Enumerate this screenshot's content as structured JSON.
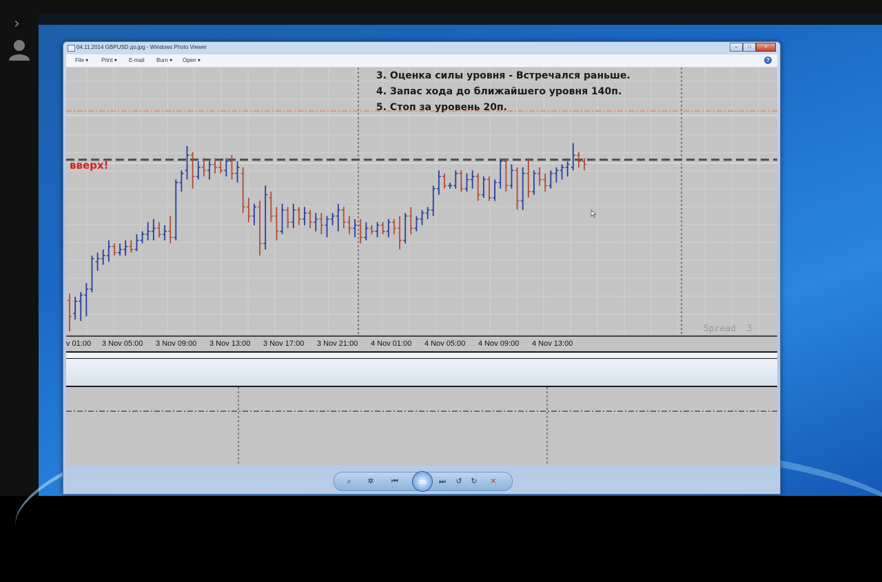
{
  "viewer": {
    "icons": [
      "chevron-right-icon",
      "user-icon"
    ]
  },
  "window": {
    "title": "04.11.2014 GBPUSD до.jpg - Windows Photo Viewer",
    "menu": [
      {
        "label": "File",
        "icon": "chevron-down-icon"
      },
      {
        "label": "Print",
        "icon": "chevron-down-icon"
      },
      {
        "label": "E-mail"
      },
      {
        "label": "Burn",
        "icon": "chevron-down-icon"
      },
      {
        "label": "Open",
        "icon": "chevron-down-icon"
      }
    ],
    "controls": {
      "minimize": "–",
      "maximize": "□",
      "close": "×"
    },
    "help": "?"
  },
  "image": {
    "notes": [
      "3. Оценка силы уровня - Встречался раньше.",
      "4. Запас хода до ближайшего уровня 140п.",
      "5. Стоп за уровень 20п."
    ],
    "direction_label": "вверх!",
    "spread_label": "Spread  3",
    "time_labels": [
      "v 01:00",
      "3 Nov 05:00",
      "3 Nov 09:00",
      "3 Nov 13:00",
      "3 Nov 17:00",
      "3 Nov 21:00",
      "4 Nov 01:00",
      "4 Nov 05:00",
      "4 Nov 09:00",
      "4 Nov 13:00"
    ],
    "colors": {
      "background": "#c4c4c4",
      "bull": "#2a3c9c",
      "bear": "#b34a38",
      "level_line": "#4a4a4a",
      "upper_level": "#e0885a"
    }
  },
  "chart_data": {
    "type": "ohlc",
    "bars": [
      {
        "o": 0.5,
        "h": 5,
        "l": -20,
        "c": -10
      },
      {
        "o": -8,
        "h": 3,
        "l": -12,
        "c": 0
      },
      {
        "o": 0,
        "h": 6,
        "l": -13,
        "c": 4
      },
      {
        "o": 4,
        "h": 12,
        "l": -10,
        "c": 8
      },
      {
        "o": 8,
        "h": 30,
        "l": 6,
        "c": 28
      },
      {
        "o": 26,
        "h": 32,
        "l": 20,
        "c": 28
      },
      {
        "o": 28,
        "h": 34,
        "l": 24,
        "c": 30
      },
      {
        "o": 30,
        "h": 40,
        "l": 26,
        "c": 36
      },
      {
        "o": 36,
        "h": 38,
        "l": 30,
        "c": 32
      },
      {
        "o": 32,
        "h": 38,
        "l": 30,
        "c": 34
      },
      {
        "o": 34,
        "h": 40,
        "l": 30,
        "c": 36
      },
      {
        "o": 36,
        "h": 40,
        "l": 32,
        "c": 34
      },
      {
        "o": 34,
        "h": 44,
        "l": 33,
        "c": 40
      },
      {
        "o": 40,
        "h": 46,
        "l": 38,
        "c": 44
      },
      {
        "o": 44,
        "h": 52,
        "l": 40,
        "c": 46
      },
      {
        "o": 46,
        "h": 54,
        "l": 40,
        "c": 48
      },
      {
        "o": 48,
        "h": 52,
        "l": 42,
        "c": 44
      },
      {
        "o": 44,
        "h": 50,
        "l": 40,
        "c": 46
      },
      {
        "o": 46,
        "h": 56,
        "l": 38,
        "c": 42
      },
      {
        "o": 42,
        "h": 80,
        "l": 40,
        "c": 78
      },
      {
        "o": 78,
        "h": 86,
        "l": 72,
        "c": 84
      },
      {
        "o": 86,
        "h": 102,
        "l": 80,
        "c": 96
      },
      {
        "o": 96,
        "h": 98,
        "l": 74,
        "c": 82
      },
      {
        "o": 82,
        "h": 92,
        "l": 80,
        "c": 88
      },
      {
        "o": 88,
        "h": 94,
        "l": 82,
        "c": 86
      },
      {
        "o": 86,
        "h": 92,
        "l": 80,
        "c": 90
      },
      {
        "o": 90,
        "h": 94,
        "l": 84,
        "c": 88
      },
      {
        "o": 88,
        "h": 92,
        "l": 84,
        "c": 86
      },
      {
        "o": 86,
        "h": 94,
        "l": 82,
        "c": 92
      },
      {
        "o": 92,
        "h": 96,
        "l": 80,
        "c": 84
      },
      {
        "o": 84,
        "h": 92,
        "l": 78,
        "c": 88
      },
      {
        "o": 84,
        "h": 88,
        "l": 58,
        "c": 62
      },
      {
        "o": 62,
        "h": 68,
        "l": 52,
        "c": 56
      },
      {
        "o": 56,
        "h": 64,
        "l": 50,
        "c": 62
      },
      {
        "o": 62,
        "h": 66,
        "l": 30,
        "c": 38
      },
      {
        "o": 38,
        "h": 76,
        "l": 34,
        "c": 70
      },
      {
        "o": 68,
        "h": 72,
        "l": 52,
        "c": 56
      },
      {
        "o": 56,
        "h": 62,
        "l": 40,
        "c": 46
      },
      {
        "o": 46,
        "h": 64,
        "l": 44,
        "c": 60
      },
      {
        "o": 60,
        "h": 62,
        "l": 48,
        "c": 52
      },
      {
        "o": 52,
        "h": 64,
        "l": 48,
        "c": 60
      },
      {
        "o": 60,
        "h": 62,
        "l": 50,
        "c": 54
      },
      {
        "o": 54,
        "h": 62,
        "l": 50,
        "c": 58
      },
      {
        "o": 58,
        "h": 60,
        "l": 48,
        "c": 52
      },
      {
        "o": 52,
        "h": 58,
        "l": 46,
        "c": 54
      },
      {
        "o": 54,
        "h": 58,
        "l": 44,
        "c": 50
      },
      {
        "o": 50,
        "h": 56,
        "l": 42,
        "c": 54
      },
      {
        "o": 54,
        "h": 58,
        "l": 50,
        "c": 56
      },
      {
        "o": 56,
        "h": 64,
        "l": 46,
        "c": 60
      },
      {
        "o": 60,
        "h": 62,
        "l": 48,
        "c": 52
      },
      {
        "o": 52,
        "h": 56,
        "l": 44,
        "c": 48
      },
      {
        "o": 48,
        "h": 54,
        "l": 42,
        "c": 50
      },
      {
        "o": 50,
        "h": 54,
        "l": 38,
        "c": 42
      },
      {
        "o": 42,
        "h": 52,
        "l": 40,
        "c": 48
      },
      {
        "o": 48,
        "h": 50,
        "l": 44,
        "c": 46
      },
      {
        "o": 46,
        "h": 52,
        "l": 42,
        "c": 50
      },
      {
        "o": 50,
        "h": 52,
        "l": 44,
        "c": 46
      },
      {
        "o": 46,
        "h": 54,
        "l": 42,
        "c": 52
      },
      {
        "o": 52,
        "h": 54,
        "l": 44,
        "c": 48
      },
      {
        "o": 48,
        "h": 56,
        "l": 34,
        "c": 40
      },
      {
        "o": 40,
        "h": 58,
        "l": 38,
        "c": 56
      },
      {
        "o": 56,
        "h": 62,
        "l": 44,
        "c": 48
      },
      {
        "o": 48,
        "h": 56,
        "l": 46,
        "c": 54
      },
      {
        "o": 54,
        "h": 60,
        "l": 50,
        "c": 58
      },
      {
        "o": 58,
        "h": 62,
        "l": 54,
        "c": 60
      },
      {
        "o": 60,
        "h": 76,
        "l": 56,
        "c": 74
      },
      {
        "o": 74,
        "h": 86,
        "l": 70,
        "c": 82
      },
      {
        "o": 82,
        "h": 84,
        "l": 74,
        "c": 76
      },
      {
        "o": 76,
        "h": 78,
        "l": 74,
        "c": 76
      },
      {
        "o": 76,
        "h": 86,
        "l": 74,
        "c": 84
      },
      {
        "o": 84,
        "h": 86,
        "l": 72,
        "c": 74
      },
      {
        "o": 74,
        "h": 84,
        "l": 72,
        "c": 80
      },
      {
        "o": 80,
        "h": 86,
        "l": 74,
        "c": 82
      },
      {
        "o": 82,
        "h": 84,
        "l": 66,
        "c": 70
      },
      {
        "o": 70,
        "h": 82,
        "l": 68,
        "c": 80
      },
      {
        "o": 80,
        "h": 82,
        "l": 66,
        "c": 68
      },
      {
        "o": 68,
        "h": 80,
        "l": 66,
        "c": 78
      },
      {
        "o": 78,
        "h": 94,
        "l": 74,
        "c": 92
      },
      {
        "o": 92,
        "h": 94,
        "l": 72,
        "c": 76
      },
      {
        "o": 76,
        "h": 90,
        "l": 74,
        "c": 86
      },
      {
        "o": 86,
        "h": 88,
        "l": 60,
        "c": 66
      },
      {
        "o": 66,
        "h": 88,
        "l": 60,
        "c": 84
      },
      {
        "o": 84,
        "h": 94,
        "l": 68,
        "c": 72
      },
      {
        "o": 72,
        "h": 86,
        "l": 70,
        "c": 84
      },
      {
        "o": 84,
        "h": 88,
        "l": 76,
        "c": 80
      },
      {
        "o": 80,
        "h": 84,
        "l": 72,
        "c": 76
      },
      {
        "o": 76,
        "h": 86,
        "l": 74,
        "c": 84
      },
      {
        "o": 84,
        "h": 88,
        "l": 78,
        "c": 86
      },
      {
        "o": 86,
        "h": 90,
        "l": 80,
        "c": 88
      },
      {
        "o": 88,
        "h": 92,
        "l": 82,
        "c": 90
      },
      {
        "o": 88,
        "h": 104,
        "l": 86,
        "c": 96
      },
      {
        "o": 96,
        "h": 98,
        "l": 88,
        "c": 92
      },
      {
        "o": 92,
        "h": 94,
        "l": 86,
        "c": 90
      }
    ],
    "levels": [
      {
        "value": 93,
        "style": "dashed"
      },
      {
        "value": 125,
        "style": "dash-dot"
      }
    ],
    "ylim": [
      -22,
      150
    ]
  },
  "toolbar": {
    "buttons": [
      {
        "name": "zoom-button",
        "glyph": "⌕",
        "icon": "zoom-icon"
      },
      {
        "name": "fit-button",
        "glyph": "✲",
        "icon": "fit-window-icon"
      },
      {
        "name": "previous-button",
        "glyph": "⏮",
        "icon": "previous-icon"
      },
      {
        "name": "slideshow-button",
        "glyph": "▭",
        "icon": "slideshow-icon"
      },
      {
        "name": "next-button",
        "glyph": "⏭",
        "icon": "next-icon"
      },
      {
        "name": "rotate-left-button",
        "glyph": "↺",
        "icon": "rotate-ccw-icon"
      },
      {
        "name": "rotate-right-button",
        "glyph": "↻",
        "icon": "rotate-cw-icon"
      },
      {
        "name": "delete-button",
        "glyph": "✕",
        "icon": "delete-icon"
      }
    ]
  }
}
